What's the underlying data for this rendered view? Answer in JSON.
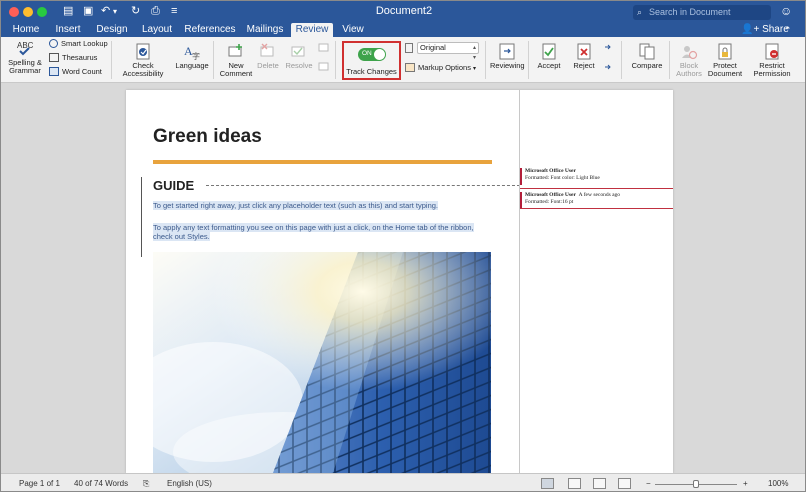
{
  "window": {
    "title": "Document2",
    "search_placeholder": "Search in Document",
    "share_label": "Share"
  },
  "tabs": [
    "Home",
    "Insert",
    "Design",
    "Layout",
    "References",
    "Mailings",
    "Review",
    "View"
  ],
  "active_tab": "Review",
  "ribbon": {
    "spelling_grammar": "Spelling & Grammar",
    "smart_lookup": "Smart Lookup",
    "thesaurus": "Thesaurus",
    "word_count": "Word Count",
    "check_accessibility": "Check Accessibility",
    "language": "Language",
    "new_comment": "New Comment",
    "delete": "Delete",
    "resolve": "Resolve",
    "track_changes": "Track Changes",
    "toggle_state": "ON",
    "markup_view": "Original",
    "markup_options": "Markup Options",
    "reviewing": "Reviewing",
    "accept": "Accept",
    "reject": "Reject",
    "compare": "Compare",
    "block_authors": "Block Authors",
    "protect_document": "Protect Document",
    "restrict_permission": "Restrict Permission"
  },
  "document": {
    "title": "Green ideas",
    "heading": "GUIDE",
    "para1": "To get started right away, just click any placeholder text (such as this) and start typing.",
    "para2a": "To apply any text formatting you see on this page with just a click, on the Home tab of the ribbon,",
    "para2b": "check out Styles."
  },
  "comments": [
    {
      "author": "Microsoft Office User",
      "time": "",
      "detail": "Formatted: Font color: Light Blue"
    },
    {
      "author": "Microsoft Office User",
      "time": "A few seconds ago",
      "detail": "Formatted: Font:16 pt"
    }
  ],
  "status": {
    "page": "Page 1 of 1",
    "words": "40 of 74 Words",
    "language": "English (US)",
    "zoom": "100%"
  }
}
